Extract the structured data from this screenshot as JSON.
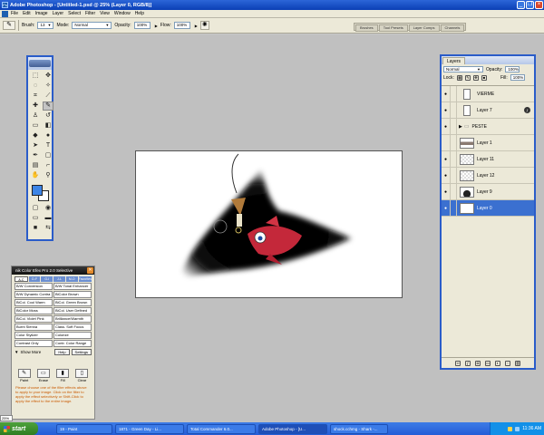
{
  "window": {
    "title": "Adobe Photoshop - [Untitled-1.psd @ 25% (Layer 0, RGB/8)]",
    "minimize": "_",
    "restore": "❐",
    "close": "×"
  },
  "menu": [
    "File",
    "Edit",
    "Image",
    "Layer",
    "Select",
    "Filter",
    "View",
    "Window",
    "Help"
  ],
  "options": {
    "brush_label": "Brush:",
    "brush_size": "13",
    "mode_label": "Mode:",
    "mode_value": "Normal",
    "opacity_label": "Opacity:",
    "opacity_value": "100%",
    "flow_label": "Flow:",
    "flow_value": "100%"
  },
  "palette_well": [
    "Brushes",
    "Tool Presets",
    "Layer Comps",
    "Channels"
  ],
  "layers_panel": {
    "tab": "Layers",
    "blend_mode": "Normal",
    "opacity_label": "Opacity:",
    "opacity_value": "100%",
    "lock_label": "Lock:",
    "fill_label": "Fill:",
    "fill_value": "100%",
    "layers": [
      {
        "name": "VIERME",
        "thumb": "tall",
        "visible": true,
        "selected": false
      },
      {
        "name": "Layer 7",
        "thumb": "tall",
        "visible": true,
        "selected": false,
        "fx": true
      },
      {
        "name": "PESTE",
        "thumb": "folder",
        "visible": true,
        "selected": false
      },
      {
        "name": "Layer 1",
        "thumb": "bar",
        "visible": false,
        "selected": false
      },
      {
        "name": "Layer 11",
        "thumb": "checker",
        "visible": true,
        "selected": false
      },
      {
        "name": "Layer 12",
        "thumb": "checker",
        "visible": true,
        "selected": false
      },
      {
        "name": "Layer 9",
        "thumb": "shape",
        "visible": true,
        "selected": false
      },
      {
        "name": "Layer 0",
        "thumb": "white",
        "visible": true,
        "selected": true
      }
    ]
  },
  "nik_panel": {
    "title": "nik Color Efex Pro 2.0 Selective",
    "tabs": [
      "A-C",
      "D-F",
      "G-I",
      "J-L",
      "M-O",
      "Favorites"
    ],
    "filters": [
      "B/W Conversion",
      "B/W Tonal Enhancer",
      "B/W Dynamic Contra",
      "BiColor Brown",
      "BiCol. Cool Warm",
      "BiCol. Green Brown",
      "BiColor Moss",
      "BiCol. User Defined",
      "BiCol. Violet Pink",
      "Brilliance/Warmth",
      "Burnt Sienna",
      "Class. Soft Focus",
      "Color Stylizer",
      "Colorize",
      "Contrast Only",
      "Contr. Color Range"
    ],
    "show_more": "Show More",
    "help": "Help",
    "settings": "Settings",
    "actions": [
      "Paint",
      "Erase",
      "Fill",
      "Clear"
    ],
    "instructions": "Please choose one of the filter effects above to apply to your image. Click on the filter to apply the effect selectively or Shift-Click to apply the effect to the entire image."
  },
  "zoom": "25%",
  "taskbar": {
    "start": "start",
    "tasks": [
      "19 - Paint",
      "1871 - Green Day - Li...",
      "Total Commander 6.0...",
      "Adobe Photoshop - [U...",
      "shock.cchmg - Shark -..."
    ],
    "active_index": 3,
    "time": "11:36 AM"
  }
}
